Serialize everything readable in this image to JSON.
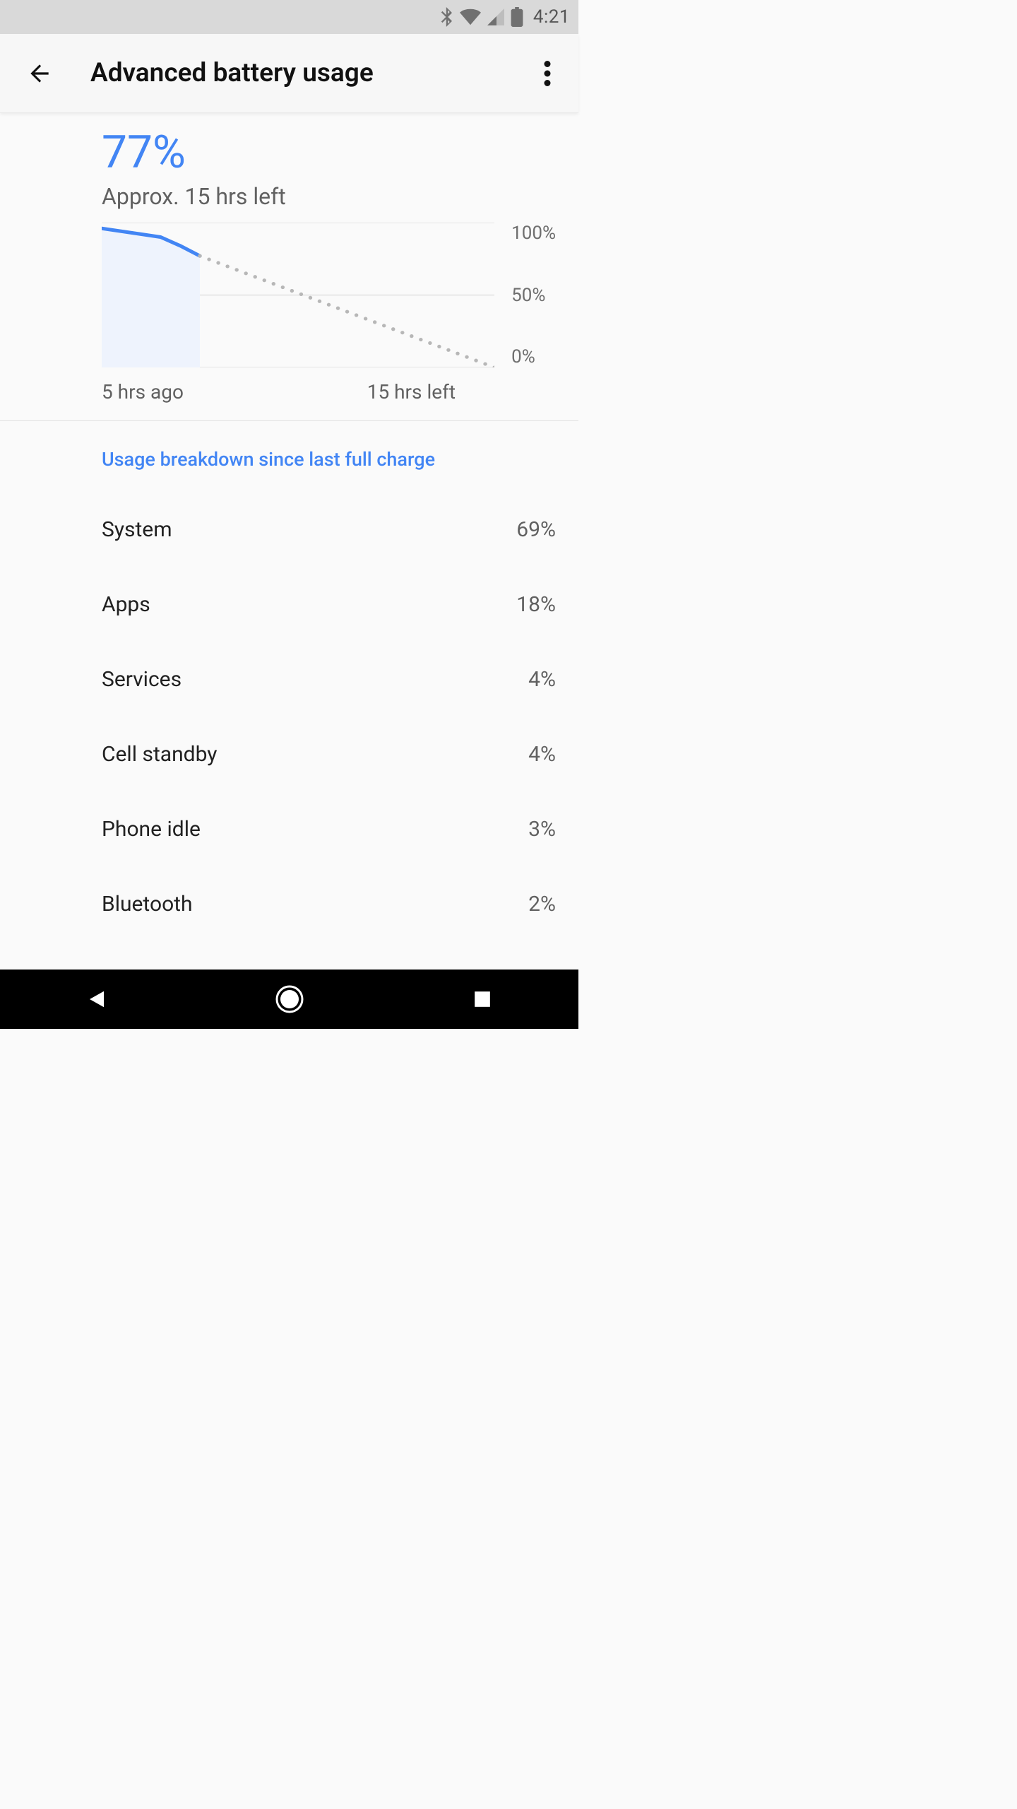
{
  "status_bar": {
    "time": "4:21"
  },
  "app_bar": {
    "title": "Advanced battery usage"
  },
  "battery": {
    "percent_label": "77%",
    "estimate": "Approx. 15 hrs left"
  },
  "chart_data": {
    "type": "line",
    "title": "",
    "xlabel": "",
    "ylabel": "",
    "ylim": [
      0,
      100
    ],
    "y_ticks": [
      "100%",
      "50%",
      "0%"
    ],
    "x_ticks": [
      "5 hrs ago",
      "15 hrs left"
    ],
    "series": [
      {
        "name": "history",
        "x": [
          0,
          2,
          3,
          4,
          5
        ],
        "values": [
          96,
          92,
          90,
          84,
          77
        ]
      },
      {
        "name": "projected",
        "x": [
          5,
          20
        ],
        "values": [
          77,
          0
        ]
      }
    ],
    "x_range": [
      0,
      20
    ],
    "x_labels": {
      "start": "5 hrs ago",
      "end": "15 hrs left"
    }
  },
  "usage": {
    "section_title": "Usage breakdown since last full charge",
    "items": [
      {
        "label": "System",
        "value": "69%"
      },
      {
        "label": "Apps",
        "value": "18%"
      },
      {
        "label": "Services",
        "value": "4%"
      },
      {
        "label": "Cell standby",
        "value": "4%"
      },
      {
        "label": "Phone idle",
        "value": "3%"
      },
      {
        "label": "Bluetooth",
        "value": "2%"
      }
    ]
  }
}
